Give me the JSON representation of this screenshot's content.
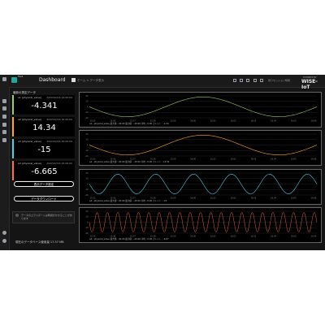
{
  "brand": {
    "name": "Fast",
    "sub": ""
  },
  "header": {
    "title": "Dashboard",
    "breadcrumb": "ホーム > データ表示",
    "session": "残りセッション時間",
    "powered": "POWERED BY",
    "product": "WISE-IoT"
  },
  "left_panel": {
    "title": "最新の測定データ",
    "cards": [
      {
        "label": "a1 (physical_value)",
        "time": "2022/02/16 16:06:00",
        "value": "-4.341",
        "accent": "#9ccc65"
      },
      {
        "label": "a2 (physical_value)",
        "time": "2022/02/16 16:06:00",
        "value": "14.34",
        "accent": "#ffa726"
      },
      {
        "label": "a3 (physical_value)",
        "time": "2022/02/16 16:06:00",
        "value": "-15",
        "accent": "#4dd0e1"
      },
      {
        "label": "a4 (physical_value)",
        "time": "2022/02/16 16:06:00",
        "value": "-6.665",
        "accent": "#ff7043"
      }
    ],
    "buttons": {
      "settings": "表示データ設定",
      "download": "データダウンロード"
    },
    "notice": "データのエクスポートは時間がかかることがあります",
    "db_usage": "現在のデータベース使用量   17.57 MB"
  },
  "charts": [
    {
      "legend": "a1 - physical_value  最大値 : 20.00  最小値 : -20.00  平均 : 0.00  カレント : -4.34",
      "color": "#9ccc65",
      "cycles": 1.5,
      "amp": 20,
      "ylabels": [
        "20",
        "10",
        "0",
        "-10",
        "-20"
      ],
      "xlabels": [
        "15:55",
        "15:56",
        "15:57",
        "15:58",
        "15:59",
        "16:00",
        "16:01",
        "16:02",
        "16:03",
        "16:04",
        "16:05",
        "16:06"
      ]
    },
    {
      "legend": "a2 - physical_value  最大値 : 20.00  最小値 : -20.00  平均 : 0.00  カレント : 14.34",
      "color": "#ffa726",
      "cycles": 1.5,
      "amp": 20,
      "ylabels": [
        "20",
        "10",
        "0",
        "-10",
        "-20"
      ],
      "xlabels": [
        "15:55",
        "15:56",
        "15:57",
        "15:58",
        "15:59",
        "16:00",
        "16:01",
        "16:02",
        "16:03",
        "16:04",
        "16:05",
        "16:06"
      ]
    },
    {
      "legend": "a3 - physical_value  最大値 : 20.00  最小値 : -20.00  平均 : 0.00  カレント : -15",
      "color": "#4dd0e1",
      "cycles": 6,
      "amp": 20,
      "ylabels": [
        "20",
        "10",
        "0",
        "-10",
        "-20"
      ],
      "xlabels": [
        "15:55",
        "15:56",
        "15:57",
        "15:58",
        "15:59",
        "16:00",
        "16:01",
        "16:02",
        "16:03",
        "16:04",
        "16:05",
        "16:06"
      ]
    },
    {
      "legend": "a4 - physical_value  最大値 : 20.00  最小値 : -20.00  平均 : 0.00  カレント : -6.67",
      "color": "#ff7043",
      "cycles": 22,
      "amp": 20,
      "ylabels": [
        "20",
        "10",
        "0",
        "-10",
        "-20"
      ],
      "xlabels": [
        "15:55",
        "15:56",
        "15:57",
        "15:58",
        "15:59",
        "16:00",
        "16:01",
        "16:02",
        "16:03",
        "16:04",
        "16:05",
        "16:06"
      ]
    }
  ]
}
